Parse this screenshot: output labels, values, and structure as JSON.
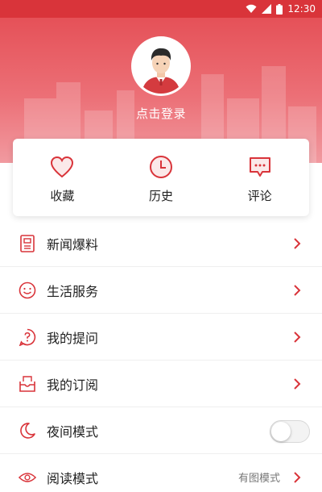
{
  "status_bar": {
    "time": "12:30",
    "icons": [
      "wifi-icon",
      "signal-icon",
      "battery-icon"
    ]
  },
  "profile": {
    "login_label": "点击登录"
  },
  "quick_actions": [
    {
      "label": "收藏",
      "icon": "heart-icon"
    },
    {
      "label": "历史",
      "icon": "clock-icon"
    },
    {
      "label": "评论",
      "icon": "comment-icon"
    }
  ],
  "menu": [
    {
      "label": "新闻爆料",
      "icon": "document-icon",
      "type": "link"
    },
    {
      "label": "生活服务",
      "icon": "smile-icon",
      "type": "link"
    },
    {
      "label": "我的提问",
      "icon": "question-icon",
      "type": "link"
    },
    {
      "label": "我的订阅",
      "icon": "inbox-icon",
      "type": "link"
    },
    {
      "label": "夜间模式",
      "icon": "moon-icon",
      "type": "toggle",
      "toggle_on": false
    },
    {
      "label": "阅读模式",
      "icon": "eye-icon",
      "type": "link",
      "value": "有图模式"
    }
  ],
  "colors": {
    "accent": "#d9343a",
    "header_top": "#e55158",
    "header_bottom": "#f19aa0"
  }
}
